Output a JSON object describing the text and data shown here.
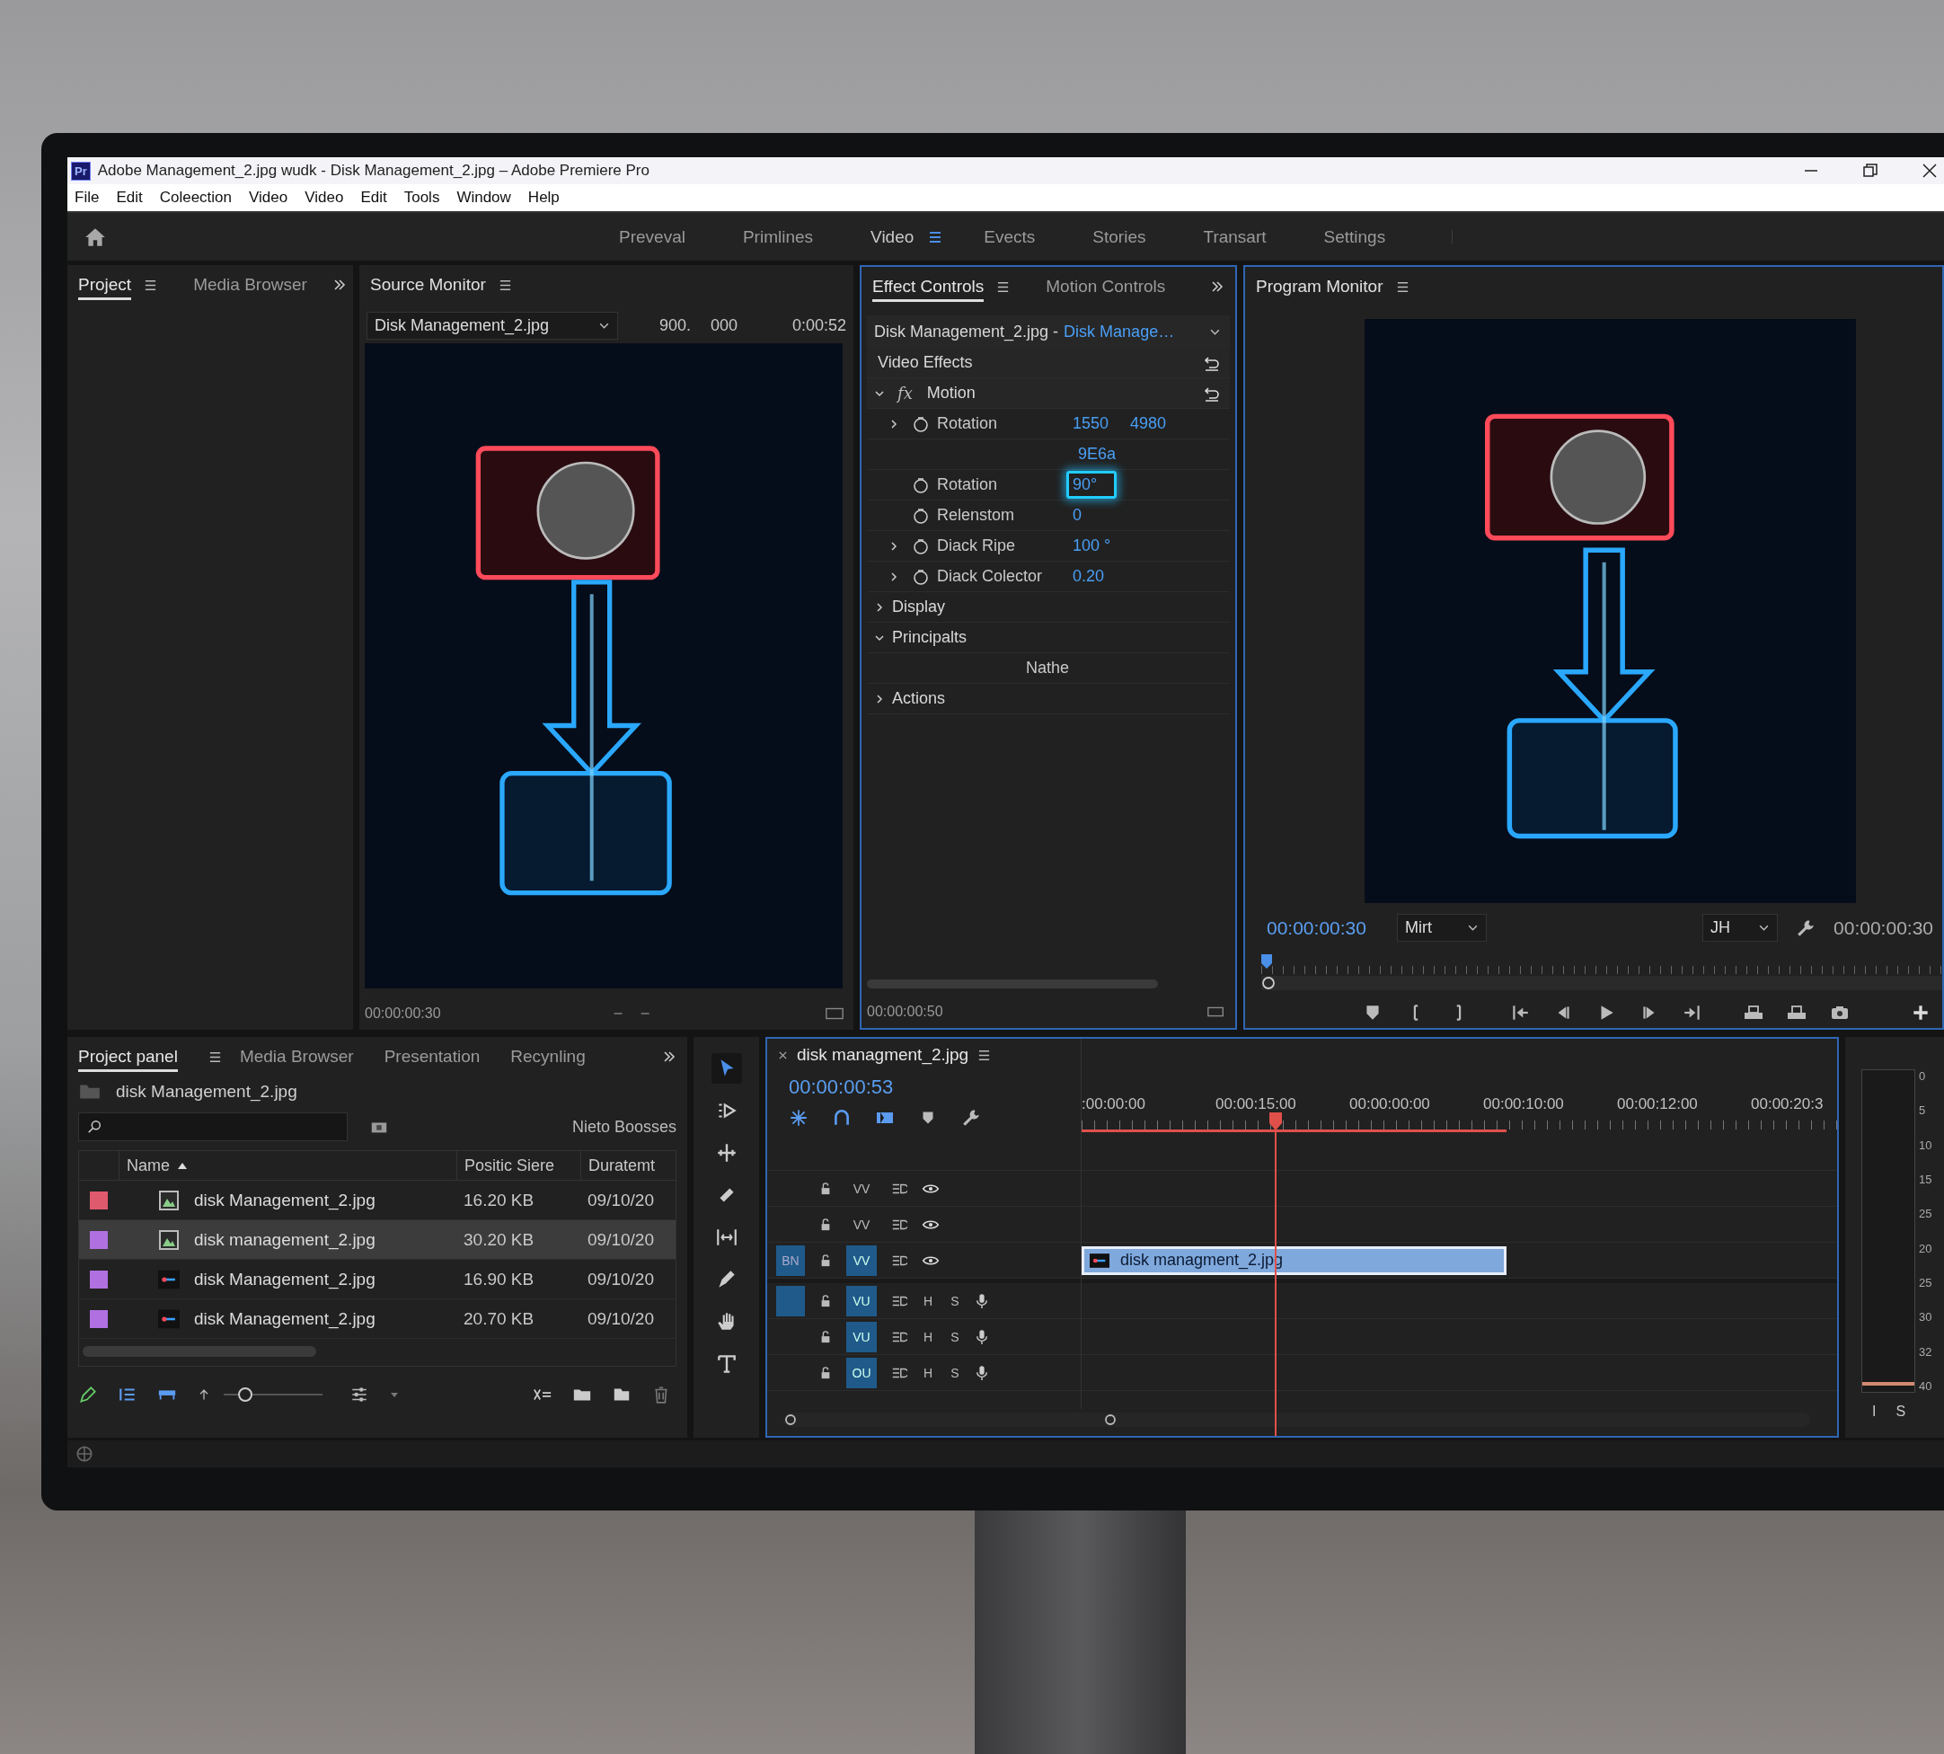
{
  "window": {
    "app_badge": "Pr",
    "title": "Adobe Management_2.jpg wudk - Disk Management_2.jpg – Adobe Premiere Pro"
  },
  "menu": [
    "File",
    "Edit",
    "Coleection",
    "Video",
    "Video",
    "Edit",
    "Tools",
    "Window",
    "Help"
  ],
  "workspaces": [
    {
      "label": "Preveval",
      "selected": false
    },
    {
      "label": "Primlines",
      "selected": false
    },
    {
      "label": "Video",
      "selected": true
    },
    {
      "label": "Evects",
      "selected": false
    },
    {
      "label": "Stories",
      "selected": false
    },
    {
      "label": "Transart",
      "selected": false
    },
    {
      "label": "Settings",
      "selected": false
    }
  ],
  "project_panel": {
    "tabs": [
      {
        "label": "Project",
        "selected": true
      },
      {
        "label": "Media Browser",
        "selected": false
      }
    ]
  },
  "source_monitor": {
    "tab": "Source Monitor",
    "clip": "Disk Management_2.jpg",
    "readout_1": "900.",
    "readout_2": "000",
    "duration": "0:00:52",
    "timecode": "00:00:00:30"
  },
  "effect_controls": {
    "tabs": [
      {
        "label": "Effect Controls",
        "selected": true
      },
      {
        "label": "Motion Controls",
        "selected": false
      }
    ],
    "clip": "Disk Management_2.jpg -",
    "clip_link": "Disk Manage…",
    "rows": [
      {
        "kind": "section",
        "label": "Video Effects"
      },
      {
        "kind": "effect",
        "badge": "fx",
        "label": "Motion",
        "expanded": true
      },
      {
        "kind": "property",
        "label": "Rotation",
        "values": [
          "1550",
          "4980"
        ],
        "expandable": true,
        "focused": false
      },
      {
        "kind": "value",
        "values": [
          "9E6a"
        ]
      },
      {
        "kind": "property",
        "label": "Rotation",
        "values": [
          "90°"
        ],
        "expandable": false,
        "focused": true
      },
      {
        "kind": "property",
        "label": "Relenstom",
        "values": [
          "0"
        ],
        "expandable": false,
        "focused": false
      },
      {
        "kind": "property",
        "label": "Diack Ripe",
        "values": [
          "100 °"
        ],
        "expandable": true,
        "focused": false
      },
      {
        "kind": "property",
        "label": "Diack Colector",
        "values": [
          "0.20"
        ],
        "expandable": true,
        "focused": false
      },
      {
        "kind": "group",
        "label": "Display",
        "expanded": false
      },
      {
        "kind": "group",
        "label": "Principalts",
        "expanded": true
      },
      {
        "kind": "note",
        "label": "Nathe"
      },
      {
        "kind": "group",
        "label": "Actions",
        "expanded": false
      }
    ],
    "timecode": "00:00:00:50"
  },
  "program_monitor": {
    "tab": "Program Monitor",
    "timecode": "00:00:00:30",
    "fit": "Mirt",
    "quality": "JH",
    "duration": "00:00:00:30"
  },
  "bottom_project": {
    "tabs": [
      {
        "label": "Project panel",
        "selected": true
      },
      {
        "label": "Media Browser",
        "selected": false
      },
      {
        "label": "Presentation",
        "selected": false
      },
      {
        "label": "Recynling",
        "selected": false
      }
    ],
    "bin": "disk Management_2.jpg",
    "items_label": "Nieto Boosses",
    "columns": [
      {
        "label": "Name",
        "sorted": true
      },
      {
        "label": "Positic Siere",
        "sorted": false
      },
      {
        "label": "Duratemt",
        "sorted": false
      }
    ],
    "rows": [
      {
        "color": "#e05a6e",
        "kind": "image",
        "name": "disk Management_2.jpg",
        "size": "16.20 KB",
        "date": "09/10/20",
        "selected": false
      },
      {
        "color": "#b070e0",
        "kind": "image",
        "name": "disk management_2.jpg",
        "size": "30.20 KB",
        "date": "09/10/20",
        "selected": true
      },
      {
        "color": "#b070e0",
        "kind": "video",
        "name": "disk Management_2.jpg",
        "size": "16.90 KB",
        "date": "09/10/20",
        "selected": false
      },
      {
        "color": "#b070e0",
        "kind": "video",
        "name": "disk Management_2.jpg",
        "size": "20.70 KB",
        "date": "09/10/20",
        "selected": false
      }
    ],
    "zoom": {
      "level": 0.25
    }
  },
  "tools": [
    {
      "kind": "selection",
      "selected": true
    },
    {
      "kind": "track-select",
      "selected": false
    },
    {
      "kind": "ripple",
      "selected": false
    },
    {
      "kind": "razor",
      "selected": false
    },
    {
      "kind": "slip",
      "selected": false
    },
    {
      "kind": "pen",
      "selected": false
    },
    {
      "kind": "hand",
      "selected": false
    },
    {
      "kind": "type",
      "selected": false
    }
  ],
  "timeline": {
    "title": "disk managment_2.jpg",
    "timecode": "00:00:00:53",
    "ruler": [
      ":00:00:00",
      "00:00:15:00",
      "00:00:00:00",
      "00:00:10:00",
      "00:00:12:00",
      "00:00:20:3"
    ],
    "tracks": [
      {
        "kind": "video",
        "label": "VV",
        "targeted": false,
        "source_patch": false
      },
      {
        "kind": "video",
        "label": "VV",
        "targeted": false,
        "source_patch": false
      },
      {
        "kind": "video",
        "label": "VV",
        "targeted": true,
        "source_patch": true,
        "patch_label": "BN",
        "clip": "disk managment_2.jpg"
      },
      {
        "kind": "audio",
        "label": "VU",
        "targeted": true,
        "source_patch": true,
        "mute": "H",
        "solo": "S"
      },
      {
        "kind": "audio",
        "label": "VU",
        "targeted": true,
        "source_patch": false,
        "mute": "H",
        "solo": "S"
      },
      {
        "kind": "audio",
        "label": "OU",
        "targeted": true,
        "source_patch": false,
        "mute": "H",
        "solo": "S"
      }
    ]
  },
  "meter": {
    "scale": [
      "0",
      "5",
      "10",
      "15",
      "25",
      "20",
      "25",
      "30",
      "32",
      "40"
    ],
    "channels": [
      "I",
      "S"
    ]
  }
}
